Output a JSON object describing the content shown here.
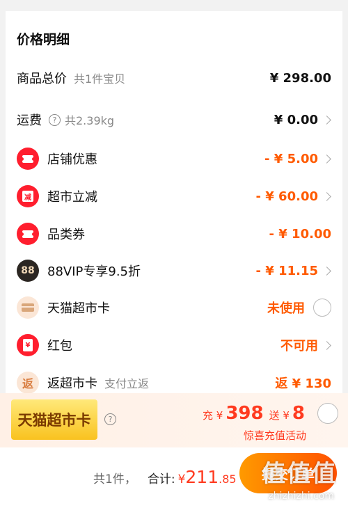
{
  "section_title": "价格明细",
  "rows": {
    "total": {
      "label": "商品总价",
      "sub": "共1件宝贝",
      "amount": "¥ 298.00"
    },
    "shipping": {
      "label": "运费",
      "sub": "共2.39kg",
      "amount": "¥ 0.00"
    },
    "shop_discount": {
      "label": "店铺优惠",
      "amount": "- ¥ 5.00"
    },
    "market_cut": {
      "label": "超市立减",
      "icon_text": "减",
      "amount": "- ¥ 60.00"
    },
    "category_coupon": {
      "label": "品类券",
      "amount": "- ¥ 10.00"
    },
    "vip": {
      "label": "88VIP专享9.5折",
      "icon_text": "88",
      "amount": "- ¥ 11.15"
    },
    "market_card": {
      "label": "天猫超市卡",
      "status": "未使用"
    },
    "red_packet": {
      "label": "红包",
      "icon_text": "¥",
      "status": "不可用"
    },
    "cashback": {
      "label": "返超市卡",
      "sub": "支付立返",
      "icon_text": "返",
      "amount": "返 ¥ 130"
    }
  },
  "promo": {
    "badge": "天猫超市卡",
    "charge_prefix": "充 ¥",
    "charge_amount": "398",
    "gift_prefix": "送 ¥",
    "gift_amount": "8",
    "subtitle": "惊喜充值活动"
  },
  "footer": {
    "count": "共1件，",
    "total_label": "合计:",
    "yen": "¥",
    "total_int": "211",
    "total_dec": ".85",
    "submit_label": "提交订单"
  },
  "watermark": {
    "logo": "值值值",
    "url": "zhizhizhi.com"
  },
  "colors": {
    "accent_red": "#ff3a1f",
    "accent_orange": "#ff5a00",
    "icon_red": "#ff1e2e"
  }
}
